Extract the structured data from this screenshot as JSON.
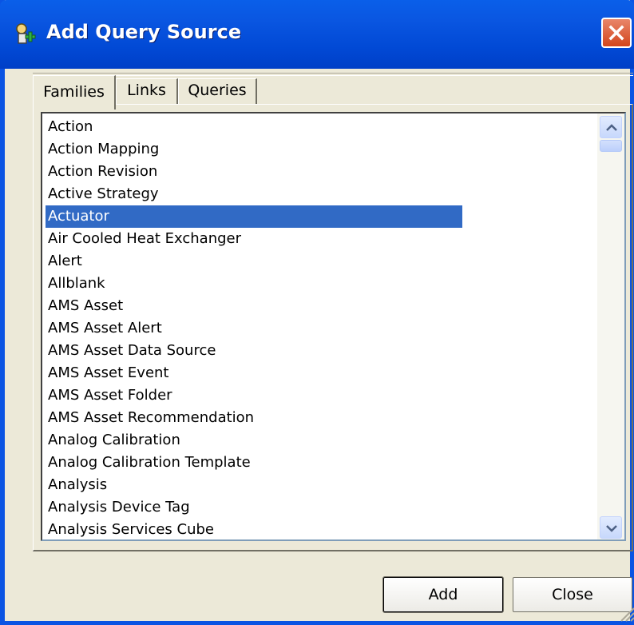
{
  "window": {
    "title": "Add Query Source"
  },
  "icons": {
    "title": "query-source-icon",
    "close": "close-icon"
  },
  "tabs": [
    {
      "label": "Families",
      "active": true
    },
    {
      "label": "Links",
      "active": false
    },
    {
      "label": "Queries",
      "active": false
    }
  ],
  "families": {
    "items": [
      "Action",
      "Action Mapping",
      "Action Revision",
      "Active Strategy",
      "Actuator",
      "Air Cooled Heat Exchanger",
      "Alert",
      "Allblank",
      "AMS Asset",
      "AMS Asset Alert",
      "AMS Asset Data Source",
      "AMS Asset Event",
      "AMS Asset Folder",
      "AMS Asset Recommendation",
      "Analog Calibration",
      "Analog Calibration Template",
      "Analysis",
      "Analysis Device Tag",
      "Analysis Services Cube"
    ],
    "selected": "Actuator"
  },
  "buttons": {
    "add": "Add",
    "close": "Close"
  },
  "colors": {
    "titlebar": "#0a56e1",
    "selection": "#316ac5",
    "face": "#ece9d8"
  }
}
